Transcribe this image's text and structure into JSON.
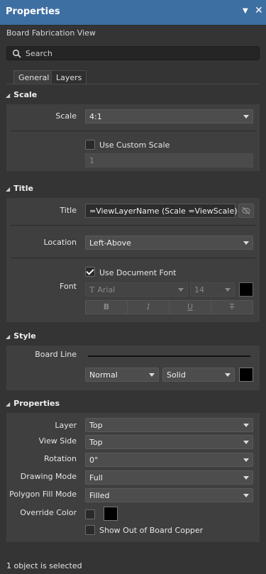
{
  "window": {
    "title": "Properties"
  },
  "subtitle": "Board Fabrication View",
  "search": {
    "placeholder": "Search"
  },
  "tabs": [
    "General",
    "Layers"
  ],
  "sections": {
    "scale": "Scale",
    "title": "Title",
    "style": "Style",
    "properties": "Properties"
  },
  "scale": {
    "label": "Scale",
    "value": "4:1",
    "use_custom_label": "Use Custom Scale",
    "use_custom_checked": false,
    "custom_value": "1"
  },
  "title": {
    "label": "Title",
    "value": "=ViewLayerName (Scale =ViewScale)",
    "location_label": "Location",
    "location_value": "Left-Above",
    "font_label": "Font",
    "use_doc_font_label": "Use Document Font",
    "use_doc_font_checked": true,
    "font_family": "Arial",
    "font_size": "14",
    "font_color": "#000000",
    "format_buttons": [
      "B",
      "I",
      "U",
      "T"
    ]
  },
  "style": {
    "board_line_label": "Board Line",
    "line_weight": "Normal",
    "line_style": "Solid",
    "line_color": "#000000"
  },
  "properties": {
    "rows": [
      {
        "label": "Layer",
        "value": "Top"
      },
      {
        "label": "View Side",
        "value": "Top"
      },
      {
        "label": "Rotation",
        "value": "0°"
      },
      {
        "label": "Drawing Mode",
        "value": "Full"
      },
      {
        "label": "Polygon Fill Mode",
        "value": "Filled"
      }
    ],
    "override_color_label": "Override Color",
    "override_color_checked": false,
    "override_color": "#000000",
    "show_out_label": "Show Out of Board Copper",
    "show_out_checked": false
  },
  "status": "1 object is selected",
  "colors": {
    "accent": "#3e6fa3",
    "panel": "#3f3f3f",
    "background": "#343434"
  }
}
